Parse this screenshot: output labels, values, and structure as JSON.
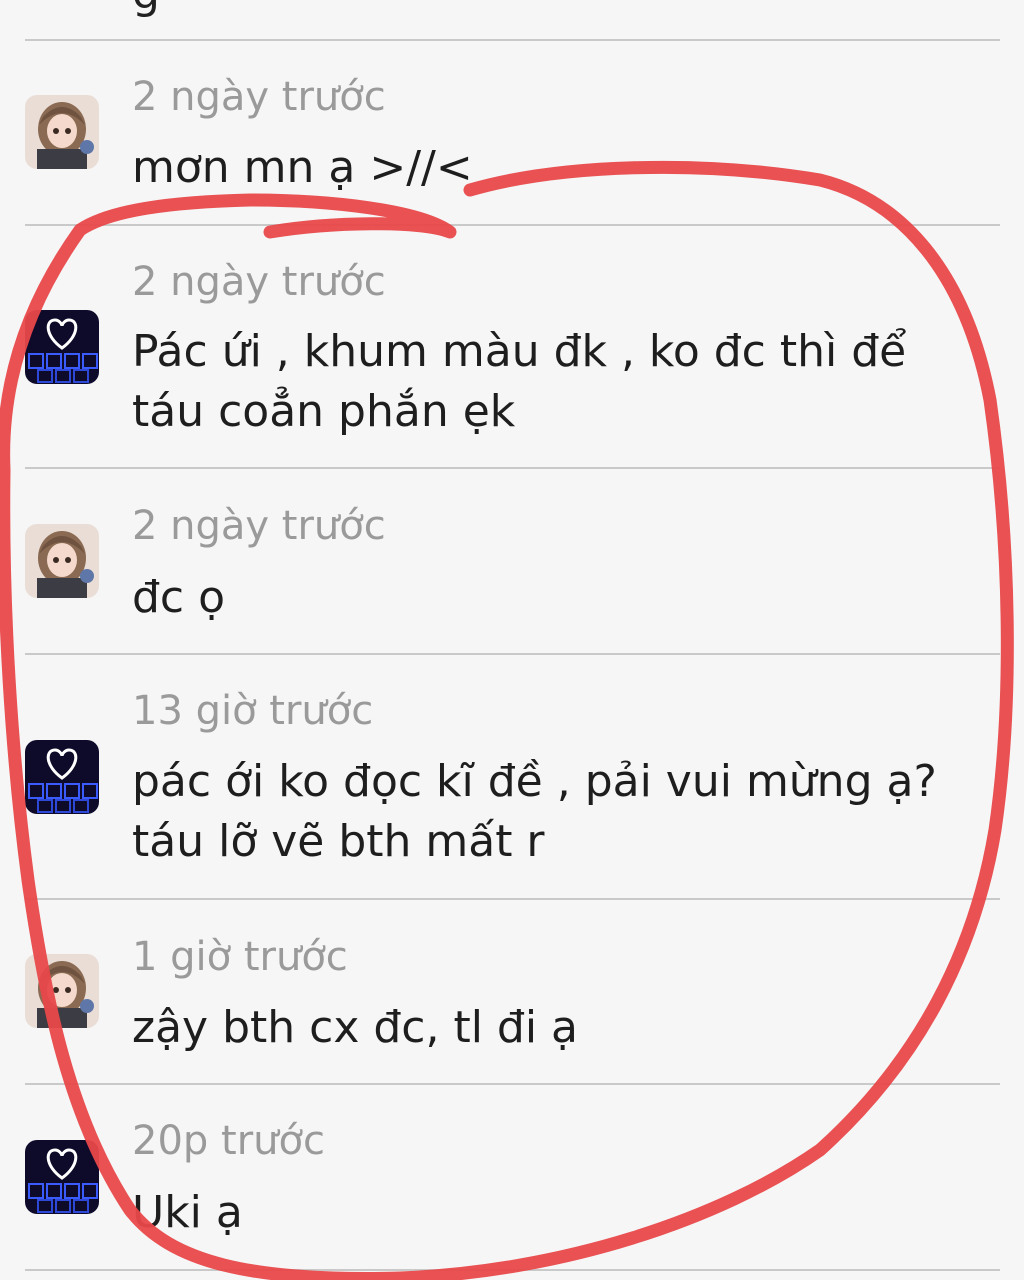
{
  "partial_text_top": "g",
  "comments": [
    {
      "avatar_icon": "anime-girl-avatar-icon",
      "time": "2 ngày trước",
      "lines": [
        "mơn mn ạ >//<"
      ]
    },
    {
      "avatar_icon": "neon-heart-avatar-icon",
      "time": "2 ngày trước",
      "lines": [
        "Pác ứi , khum màu đk , ko đc thì để",
        "táu coẳn phắn ẹk"
      ]
    },
    {
      "avatar_icon": "anime-girl-avatar-icon",
      "time": "2 ngày trước",
      "lines": [
        "đc ọ"
      ]
    },
    {
      "avatar_icon": "neon-heart-avatar-icon",
      "time": "13 giờ trước",
      "lines": [
        "pác ới ko đọc kĩ đề , pải vui mừng ạ?",
        "táu lỡ vẽ bth mất r"
      ]
    },
    {
      "avatar_icon": "anime-girl-avatar-icon",
      "time": "1 giờ trước",
      "lines": [
        "zậy bth cx đc, tl đi ạ"
      ]
    },
    {
      "avatar_icon": "neon-heart-avatar-icon",
      "time": "20p trước",
      "lines": [
        "Uki ạ"
      ]
    }
  ],
  "colors": {
    "background": "#f6f6f6",
    "divider": "#c9c9c9",
    "timestamp": "#9a9a9a",
    "text": "#1e1e1e",
    "marker": "#e8484a"
  }
}
